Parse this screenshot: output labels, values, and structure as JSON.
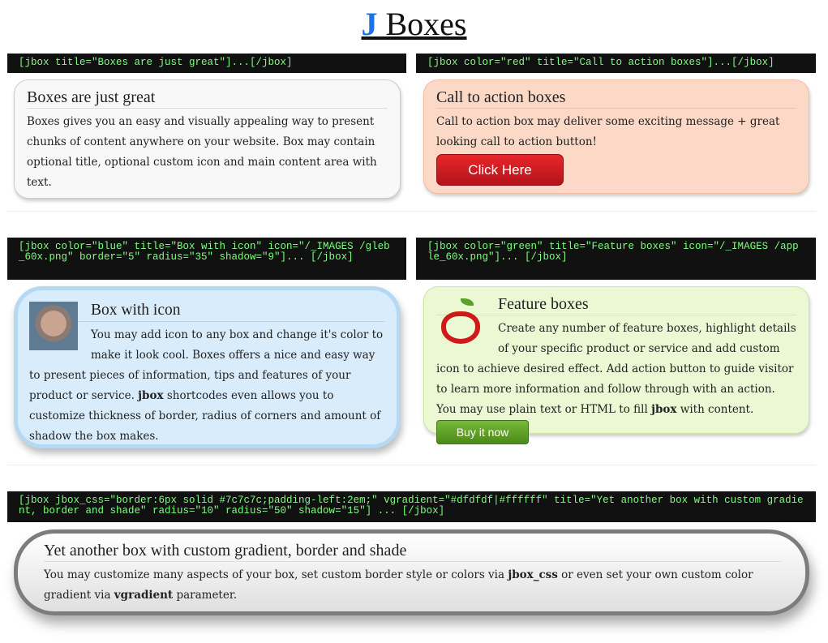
{
  "page_title_j": "J",
  "page_title_rest": "Boxes",
  "section1": {
    "left_code": "[jbox title=\"Boxes are just great\"]...[/jbox]",
    "left_title": "Boxes are just great",
    "left_text": "Boxes gives you an easy and visually appealing way to present chunks of content anywhere on your website. Box may contain optional title, optional custom icon and main content area with text.",
    "right_code": "[jbox color=\"red\" title=\"Call to action boxes\"]...[/jbox]",
    "right_title": "Call to action boxes",
    "right_text": "Call to action box may deliver some exciting message + great looking call to action button!",
    "right_button": "Click Here"
  },
  "section2": {
    "left_code": "[jbox color=\"blue\" title=\"Box with icon\" icon=\"/_IMAGES /gleb_60x.png\" border=\"5\" radius=\"35\" shadow=\"9\"]... [/jbox]",
    "left_title": "Box with icon",
    "left_text_a": "You may add icon to any box and change it's color to make it look cool. Boxes offers a nice and easy way to present pieces of information, tips and features of your product or service. ",
    "left_text_bold": "jbox",
    "left_text_b": " shortcodes even allows you to customize thickness of border, radius of corners and amount of shadow the box makes.",
    "right_code": "[jbox color=\"green\" title=\"Feature boxes\" icon=\"/_IMAGES /apple_60x.png\"]... [/jbox]",
    "right_title": "Feature boxes",
    "right_text_a": "Create any number of feature boxes, highlight details of your specific product or service and add custom icon to achieve desired effect. Add action button to guide visitor to learn more information and follow through with an action. You may use plain text or HTML to fill ",
    "right_text_bold": "jbox",
    "right_text_b": " with content.",
    "right_button": "Buy it now"
  },
  "section3": {
    "code": "[jbox jbox_css=\"border:6px solid #7c7c7c;padding-left:2em;\" vgradient=\"#dfdfdf|#ffffff\" title=\"Yet another box with custom gradient, border and shade\" radius=\"10\" radius=\"50\" shadow=\"15\"] ... [/jbox]",
    "title": "Yet another box with custom gradient, border and shade",
    "text_a": "You may customize many aspects of your box, set custom border style or colors via ",
    "bold1": "jbox_css",
    "text_b": " or even set your own custom color gradient via ",
    "bold2": "vgradient",
    "text_c": " parameter."
  }
}
